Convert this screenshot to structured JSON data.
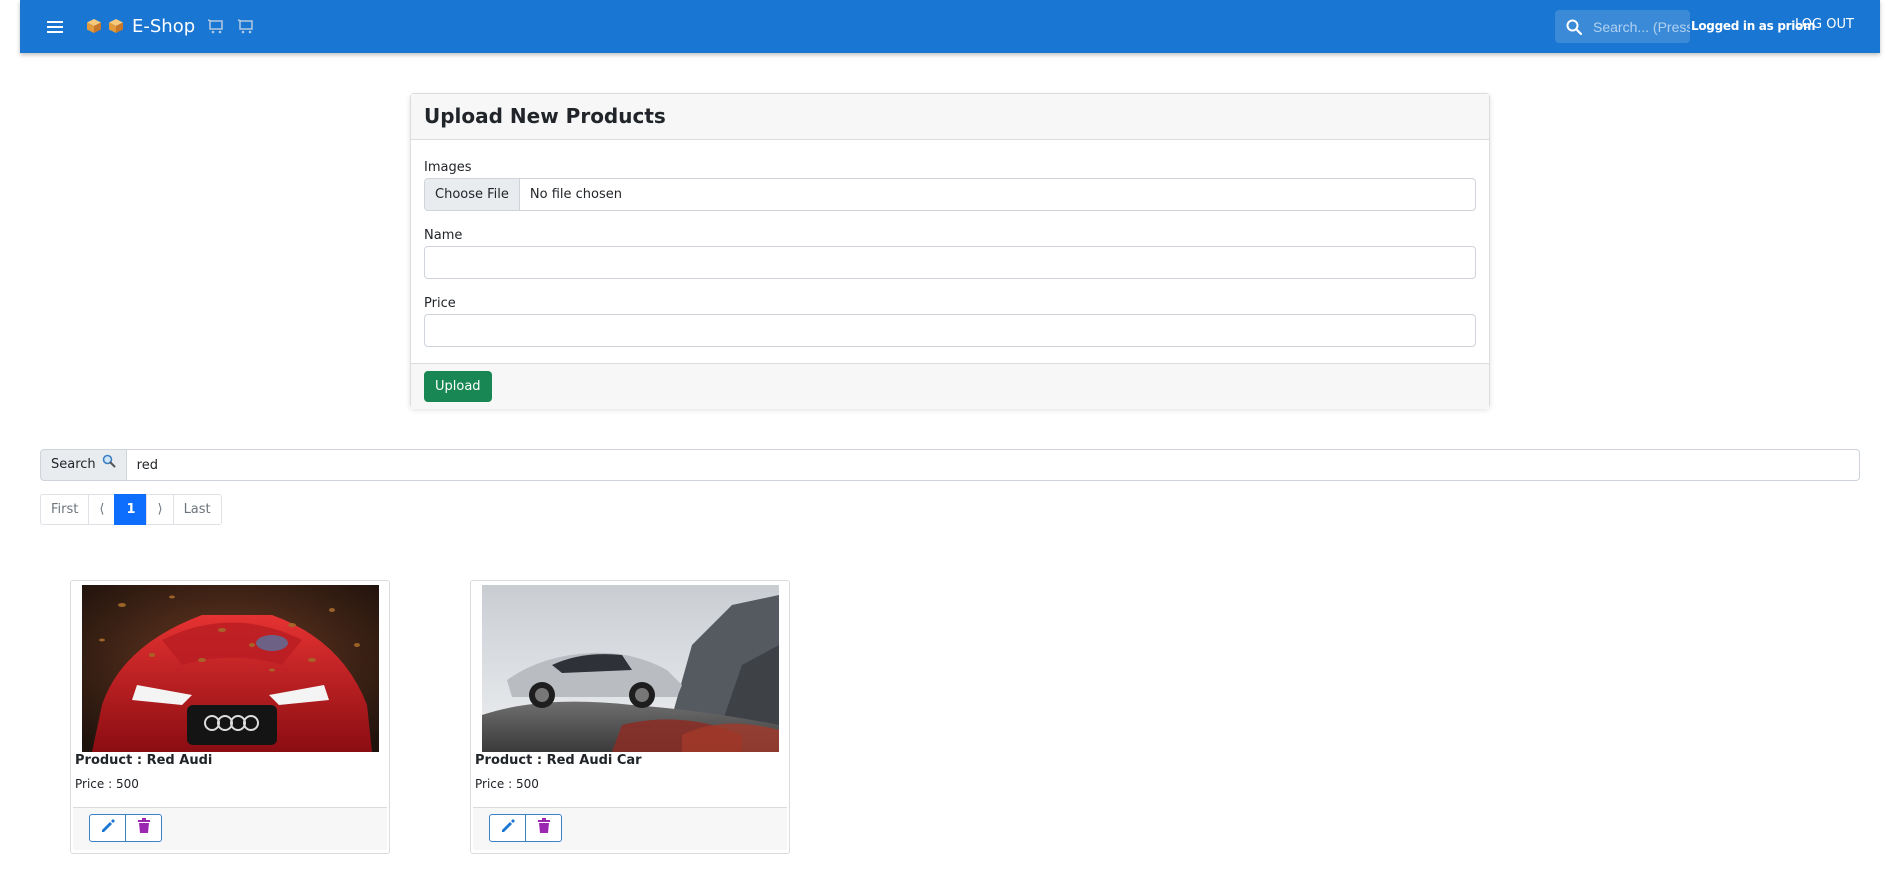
{
  "appbar": {
    "title": "E-Shop",
    "search_placeholder": "Search... (Press",
    "login_text": "Logged in as priom",
    "logout_label": "LOG OUT",
    "color": "#1976d2"
  },
  "upload_form": {
    "title": "Upload New Products",
    "images_label": "Images",
    "choose_file_label": "Choose File",
    "file_status": "No file chosen",
    "name_label": "Name",
    "name_value": "",
    "price_label": "Price",
    "price_value": "",
    "upload_label": "Upload",
    "upload_color": "#198754"
  },
  "search": {
    "label": "Search",
    "value": "red"
  },
  "pagination": {
    "first": "First",
    "prev": "⟨",
    "current": "1",
    "next": "⟩",
    "last": "Last"
  },
  "products": [
    {
      "name": "Product : Red Audi",
      "price": "Price : 500"
    },
    {
      "name": "Product : Red Audi Car",
      "price": "Price : 500"
    }
  ],
  "icons": {
    "menu": "menu-icon",
    "box": "package-icon",
    "cart": "cart-icon",
    "search": "search-icon",
    "magnifier": "magnifier-icon",
    "edit": "pencil-icon",
    "delete": "trash-icon"
  }
}
